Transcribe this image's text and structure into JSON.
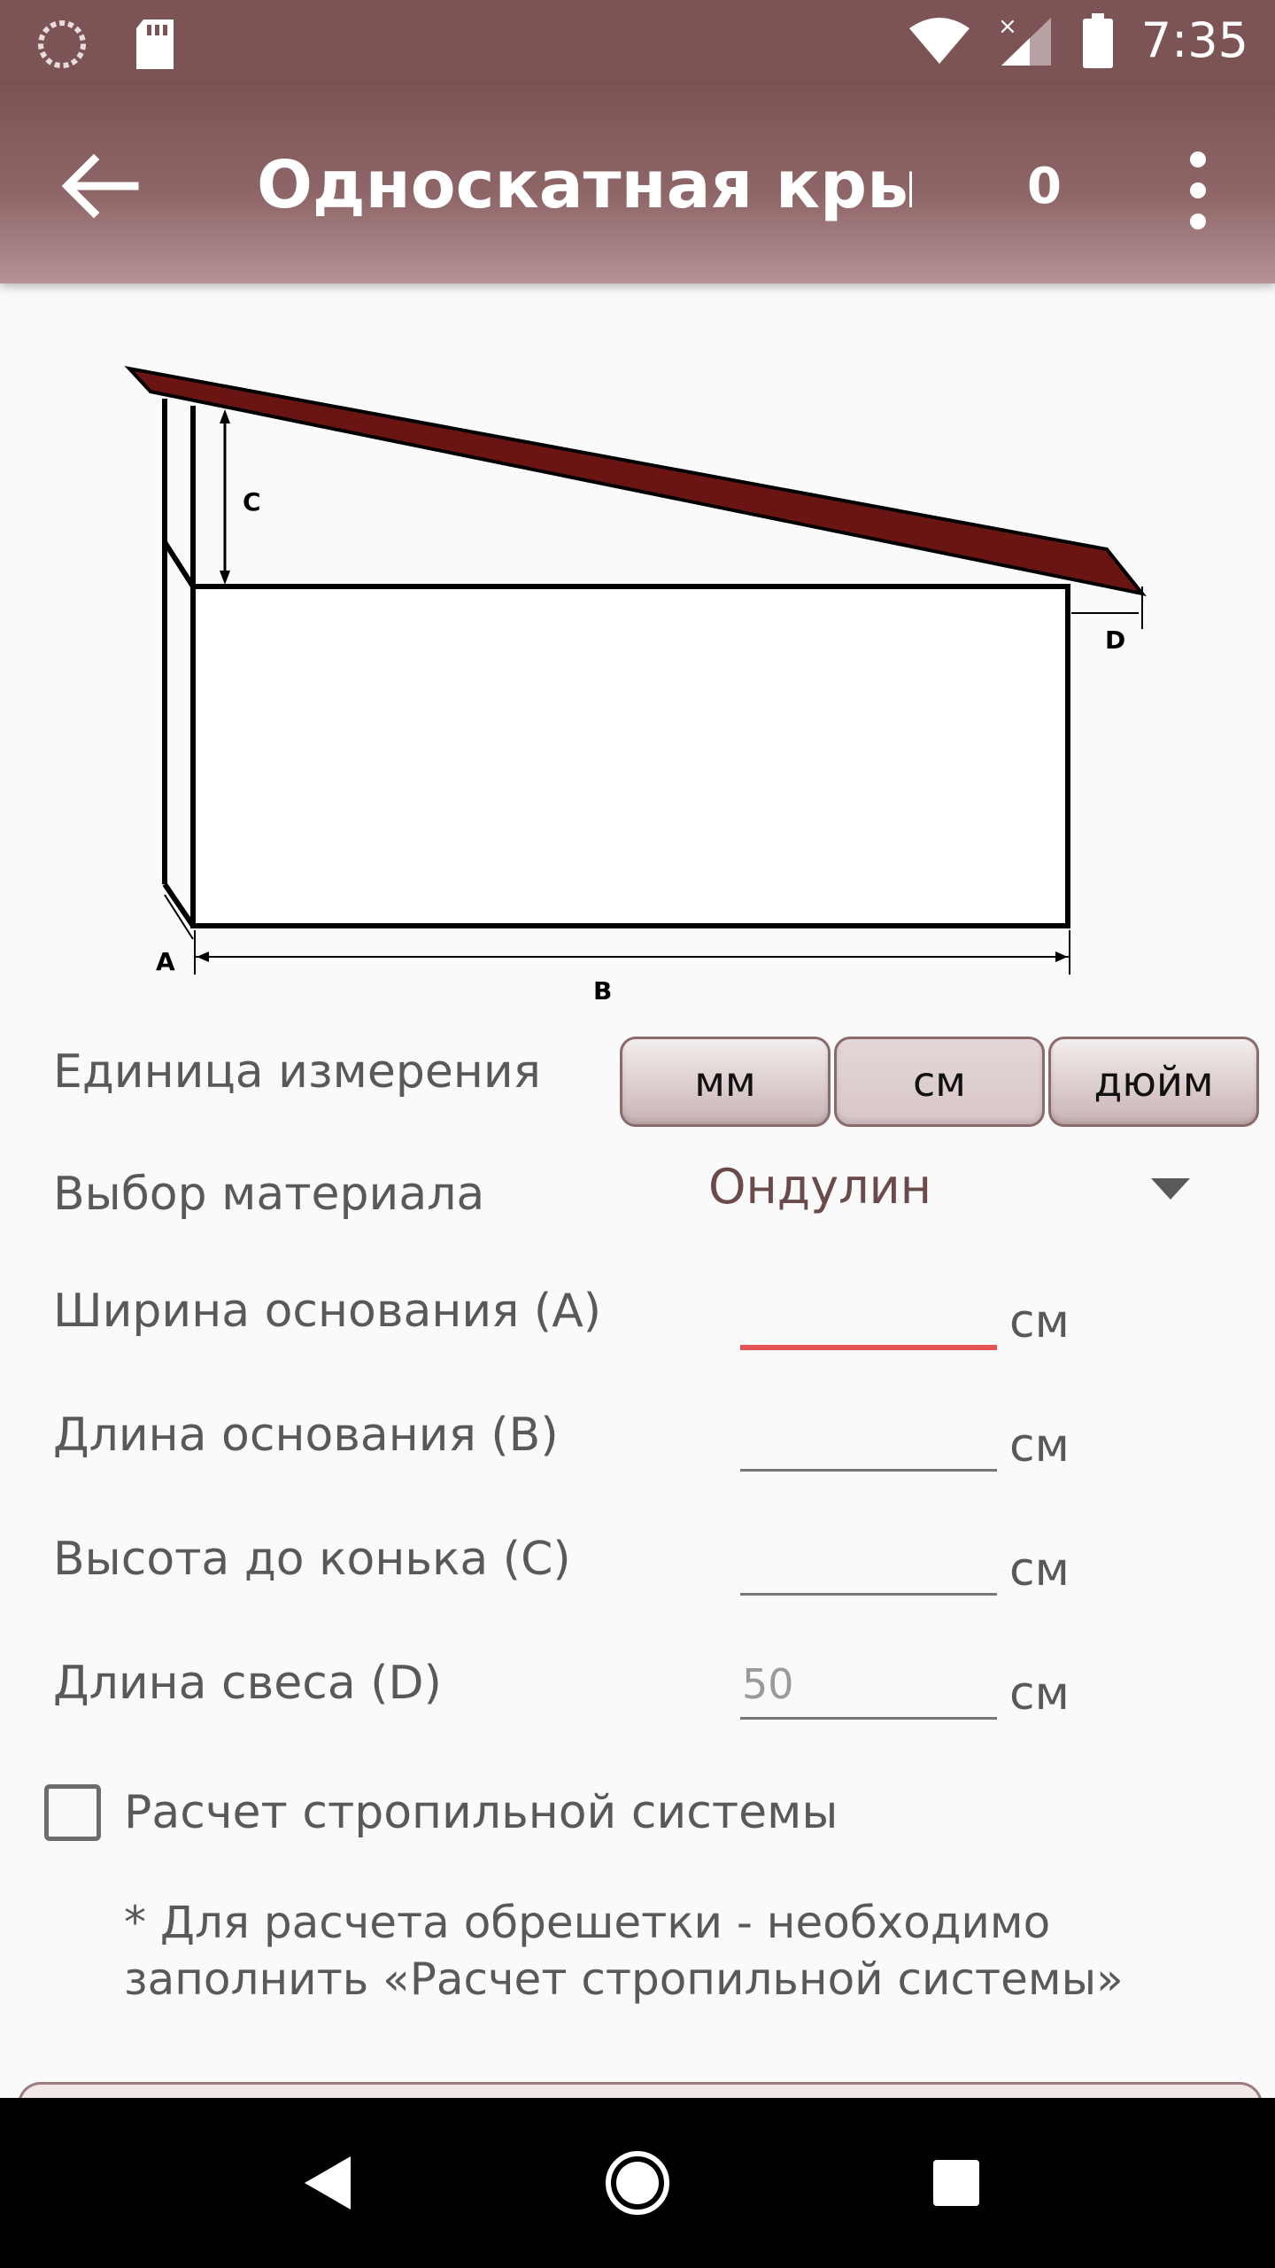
{
  "status_bar": {
    "time": "7:35"
  },
  "app_bar": {
    "title": "Односкатная кры...",
    "counter": "0"
  },
  "diagram": {
    "label_a": "A",
    "label_b": "B",
    "label_c": "C",
    "label_d": "D"
  },
  "form": {
    "unit_label": "Единица измерения",
    "units": [
      {
        "label": "мм",
        "active": false
      },
      {
        "label": "см",
        "active": true
      },
      {
        "label": "дюйм",
        "active": false
      }
    ],
    "material_label": "Выбор материала",
    "material_value": "Ондулин",
    "fields": [
      {
        "label": "Ширина основания (А)",
        "value": "",
        "unit": "см"
      },
      {
        "label": "Длина основания (В)",
        "value": "",
        "unit": "см"
      },
      {
        "label": "Высота до конька (С)",
        "value": "",
        "unit": "см"
      },
      {
        "label": "Длина свеса (D)",
        "placeholder": "50",
        "unit": "см"
      }
    ],
    "rafter_checkbox_label": "Расчет стропильной системы",
    "note": "* Для расчета обрешетки - необходимо заполнить «Расчет стропильной системы»"
  },
  "colors": {
    "accent": "#7d5456",
    "focus_underline": "#e35353",
    "roof": "#6b1414"
  }
}
